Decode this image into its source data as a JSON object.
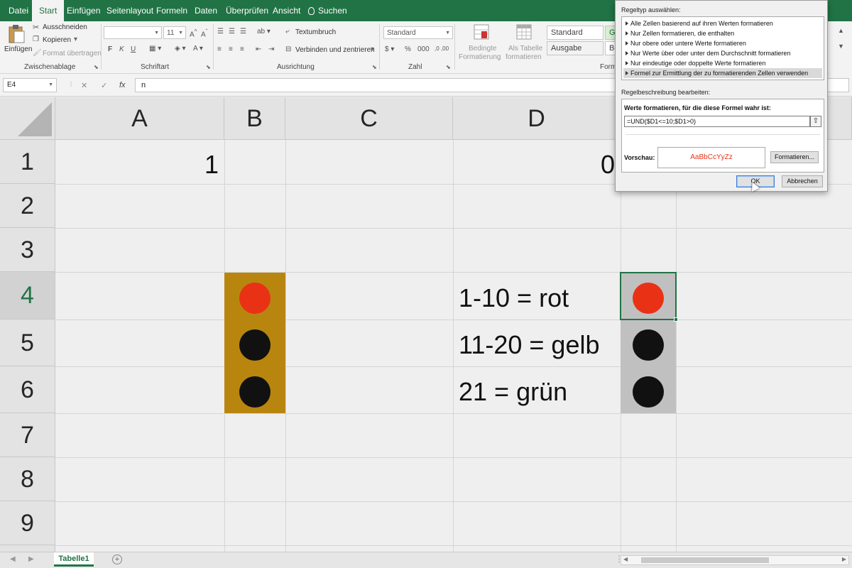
{
  "ribbon_tabs": [
    "Datei",
    "Start",
    "Einfügen",
    "Seitenlayout",
    "Formeln",
    "Daten",
    "Überprüfen",
    "Ansicht",
    "Suchen"
  ],
  "clipboard": {
    "paste_label": "Einfügen",
    "cut_label": "Ausschneiden",
    "copy_label": "Kopieren",
    "format_painter_label": "Format übertragen",
    "group_label": "Zwischenablage"
  },
  "font": {
    "size_value": "11",
    "bold": "F",
    "italic": "K",
    "underline": "U",
    "group_label": "Schriftart"
  },
  "alignment": {
    "wrap_label": "Textumbruch",
    "merge_label": "Verbinden und zentrieren",
    "group_label": "Ausrichtung"
  },
  "number": {
    "format_value": "Standard",
    "group_label": "Zahl"
  },
  "styles": {
    "conditional_label_1": "Bedingte",
    "conditional_label_2": "Formatierung",
    "table_label_1": "Als Tabelle",
    "table_label_2": "formatieren",
    "style_standard": "Standard",
    "style_ausgabe": "Ausgabe",
    "style_gut": "Gu",
    "style_be": "Be",
    "group_label_partial": "Forma"
  },
  "formula_bar": {
    "name_box": "E4",
    "fx_label": "fx",
    "content": "n"
  },
  "columns": [
    "A",
    "B",
    "C",
    "D"
  ],
  "rows": [
    "1",
    "2",
    "3",
    "4",
    "5",
    "6",
    "7",
    "8",
    "9"
  ],
  "cells": {
    "A1": "1",
    "D1": "0",
    "D4": "1-10 = rot",
    "D5": "11-20 = gelb",
    "D6": "21 = grün"
  },
  "colors": {
    "red_light": "#e93215",
    "off_light": "#111111",
    "traffic_light_body": "#b8860f",
    "traffic_light_gray": "#c0c0c0",
    "accent": "#217346"
  },
  "sheet": {
    "tab_name": "Tabelle1"
  },
  "dialog": {
    "rule_type_heading": "Regeltyp auswählen:",
    "rule_types": [
      "Alle Zellen basierend auf ihren Werten formatieren",
      "Nur Zellen formatieren, die enthalten",
      "Nur obere oder untere Werte formatieren",
      "Nur Werte über oder unter dem Durchschnitt formatieren",
      "Nur eindeutige oder doppelte Werte formatieren",
      "Formel zur Ermittlung der zu formatierenden Zellen verwenden"
    ],
    "edit_heading": "Regelbeschreibung bearbeiten:",
    "formula_label": "Werte formatieren, für die diese Formel wahr ist:",
    "formula_value": "=UND($D1<=10;$D1>0)",
    "preview_label": "Vorschau:",
    "preview_text": "AaBbCcYyZz",
    "preview_color": "#e93215",
    "format_button": "Formatieren...",
    "ok_button": "OK",
    "cancel_button": "Abbrechen"
  }
}
